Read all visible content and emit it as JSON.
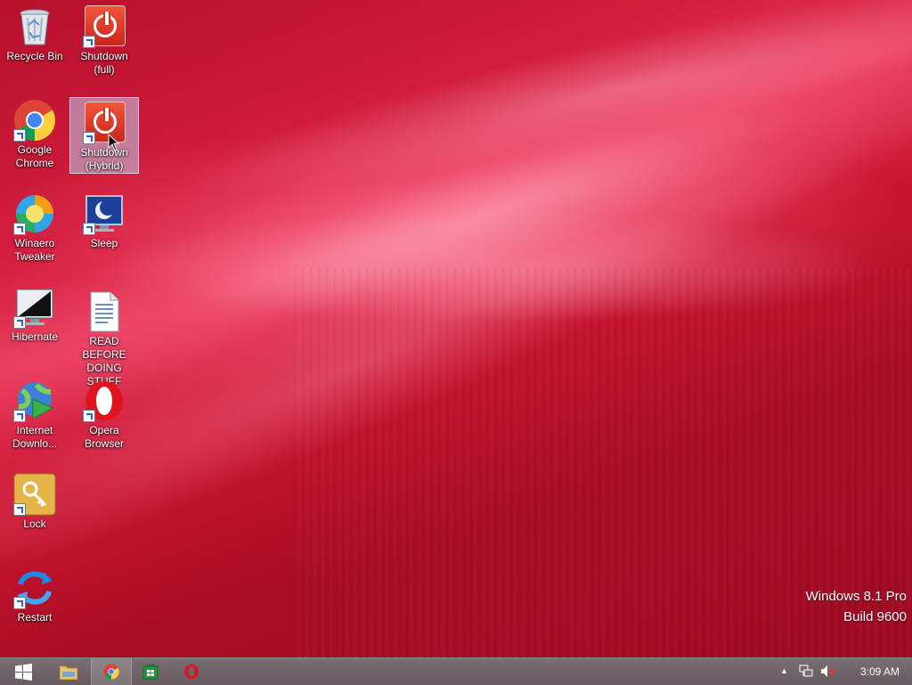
{
  "desktop": {
    "icons": [
      {
        "id": "recycle-bin",
        "label": "Recycle Bin",
        "icon": "recycle-bin-icon"
      },
      {
        "id": "shutdown-full",
        "label": "Shutdown (full)",
        "icon": "power-icon"
      },
      {
        "id": "google-chrome",
        "label": "Google Chrome",
        "icon": "chrome-icon"
      },
      {
        "id": "shutdown-hybrid",
        "label": "Shutdown (Hybrid)",
        "icon": "power-icon",
        "selected": true
      },
      {
        "id": "winaero-tweaker",
        "label": "Winaero Tweaker",
        "icon": "winaero-tweaker-icon"
      },
      {
        "id": "sleep",
        "label": "Sleep",
        "icon": "sleep-moon-icon"
      },
      {
        "id": "hibernate",
        "label": "Hibernate",
        "icon": "hibernate-monitor-icon"
      },
      {
        "id": "read-before",
        "label": "READ BEFORE DOING STUFF",
        "icon": "text-document-icon"
      },
      {
        "id": "internet-download",
        "label": "Internet Downlo...",
        "icon": "internet-download-manager-icon"
      },
      {
        "id": "opera-browser",
        "label": "Opera Browser",
        "icon": "opera-icon"
      },
      {
        "id": "lock",
        "label": "Lock",
        "icon": "key-icon"
      },
      {
        "id": "restart",
        "label": "Restart",
        "icon": "restart-arrows-icon"
      }
    ]
  },
  "watermark": {
    "line1": "Windows 8.1 Pro",
    "line2": "Build 9600"
  },
  "taskbar": {
    "buttons": [
      {
        "name": "start-button",
        "icon": "windows-logo-icon"
      },
      {
        "name": "file-explorer",
        "icon": "folder-icon"
      },
      {
        "name": "chrome",
        "icon": "chrome-icon",
        "active": true
      },
      {
        "name": "store",
        "icon": "store-icon"
      },
      {
        "name": "opera",
        "icon": "opera-icon"
      }
    ],
    "tray": {
      "overflow": "▲",
      "network": "network-icon",
      "volume": "volume-muted-icon"
    },
    "clock": "3:09 AM"
  },
  "colors": {
    "accent": "#c8102e",
    "taskbar": "#6f6267",
    "selection": "#bfcdea"
  }
}
